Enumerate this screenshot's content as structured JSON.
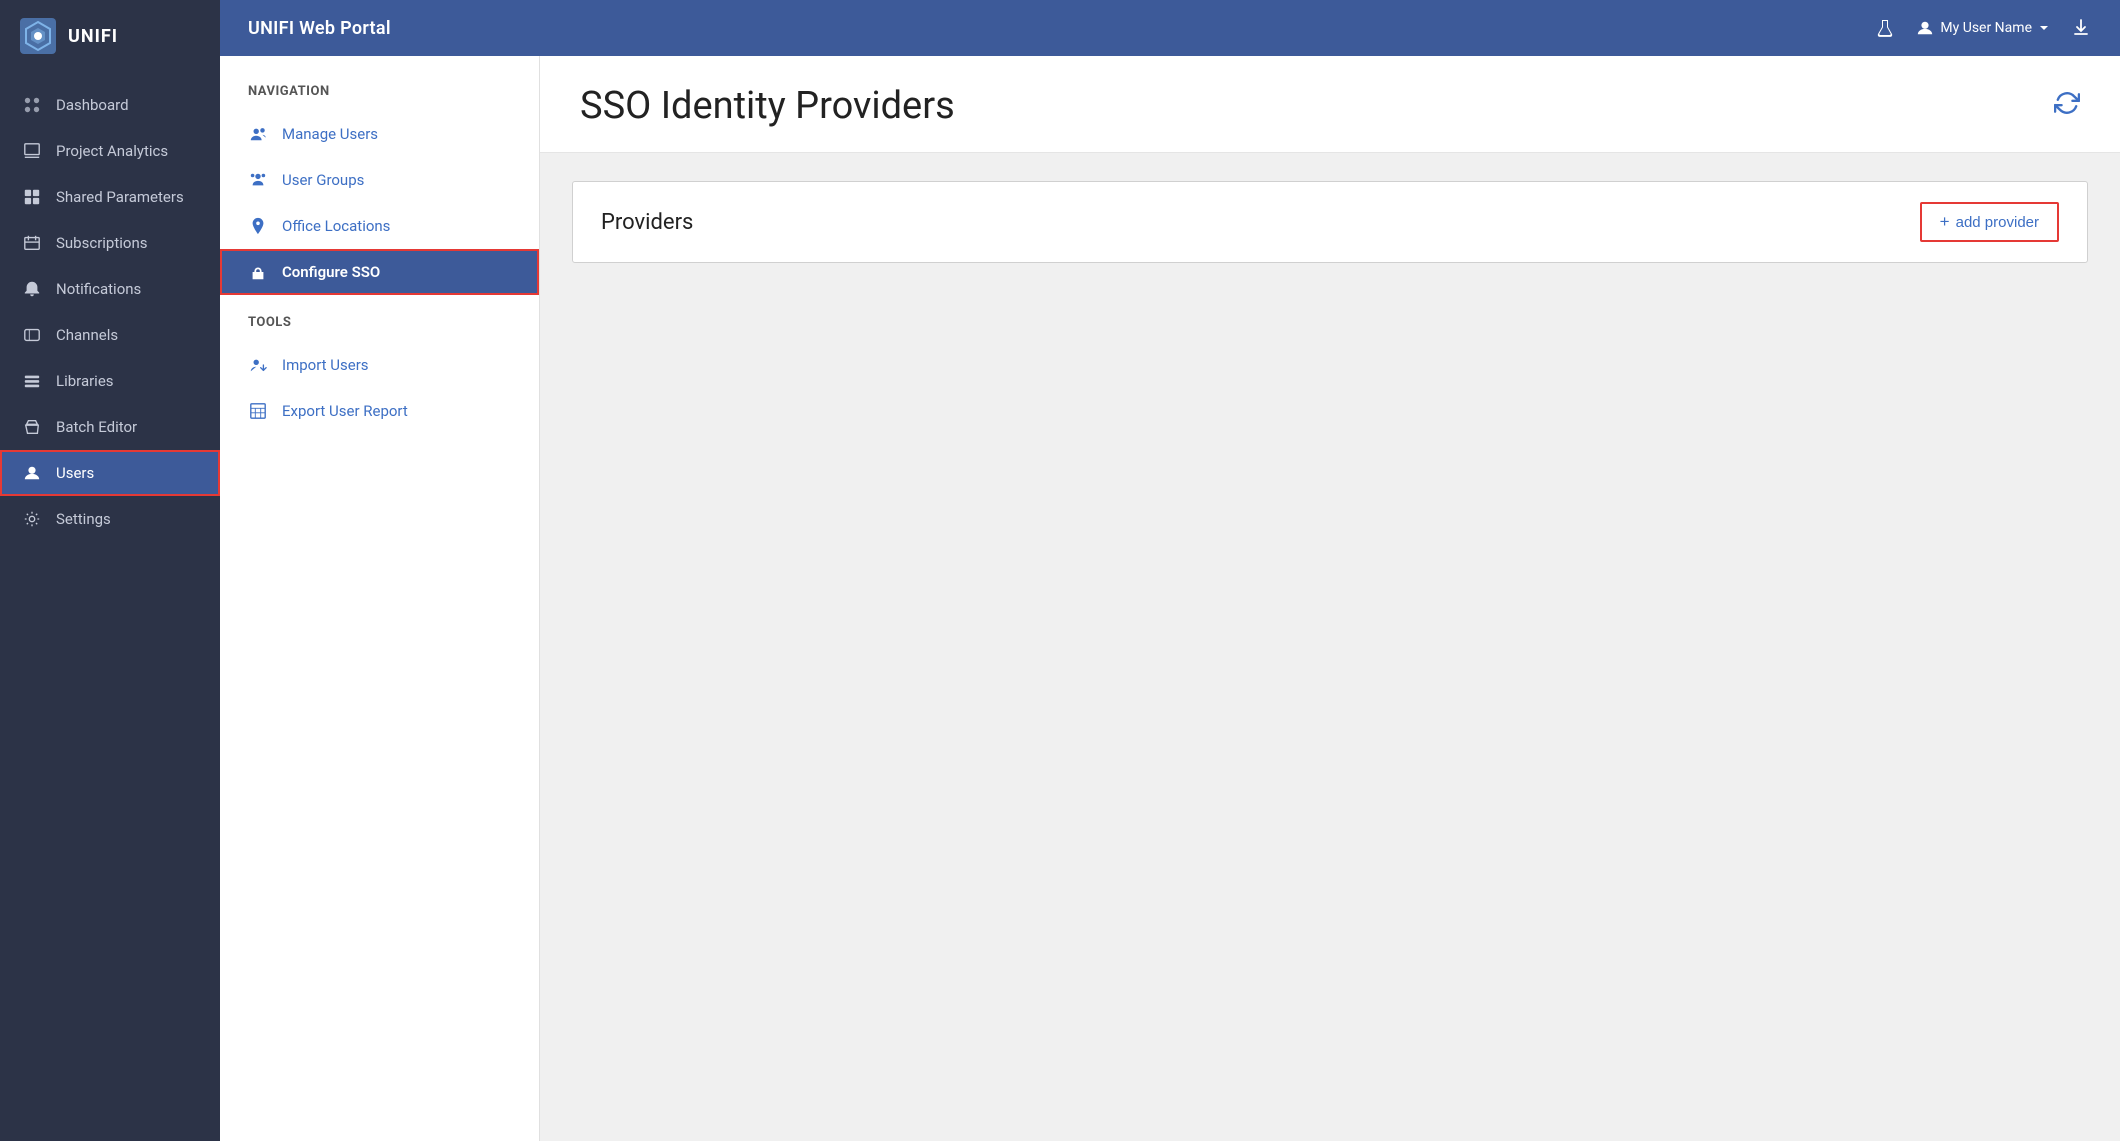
{
  "app": {
    "logo_text": "UNIFI",
    "topbar_title": "UNIFI Web Portal"
  },
  "topbar": {
    "title": "UNIFI Web Portal",
    "user_name": "My User Name",
    "icons": [
      "flask",
      "user",
      "download"
    ]
  },
  "sidebar": {
    "items": [
      {
        "id": "dashboard",
        "label": "Dashboard",
        "icon": "palette"
      },
      {
        "id": "project-analytics",
        "label": "Project Analytics",
        "icon": "book"
      },
      {
        "id": "shared-parameters",
        "label": "Shared Parameters",
        "icon": "grid"
      },
      {
        "id": "subscriptions",
        "label": "Subscriptions",
        "icon": "calendar"
      },
      {
        "id": "notifications",
        "label": "Notifications",
        "icon": "bell"
      },
      {
        "id": "channels",
        "label": "Channels",
        "icon": "monitor"
      },
      {
        "id": "libraries",
        "label": "Libraries",
        "icon": "layers"
      },
      {
        "id": "batch-editor",
        "label": "Batch Editor",
        "icon": "tag"
      },
      {
        "id": "users",
        "label": "Users",
        "icon": "user",
        "active": true
      },
      {
        "id": "settings",
        "label": "Settings",
        "icon": "gear"
      }
    ]
  },
  "sub_sidebar": {
    "navigation_label": "NAVIGATION",
    "nav_items": [
      {
        "id": "manage-users",
        "label": "Manage Users",
        "icon": "users"
      },
      {
        "id": "user-groups",
        "label": "User Groups",
        "icon": "group"
      },
      {
        "id": "office-locations",
        "label": "Office Locations",
        "icon": "pin"
      },
      {
        "id": "configure-sso",
        "label": "Configure SSO",
        "icon": "sign-in",
        "active": true
      }
    ],
    "tools_label": "TOOLS",
    "tool_items": [
      {
        "id": "import-users",
        "label": "Import Users",
        "icon": "user-add"
      },
      {
        "id": "export-user-report",
        "label": "Export User Report",
        "icon": "table"
      }
    ]
  },
  "page": {
    "title": "SSO Identity Providers",
    "providers_label": "Providers",
    "add_provider_label": "add provider",
    "add_provider_plus": "+"
  }
}
